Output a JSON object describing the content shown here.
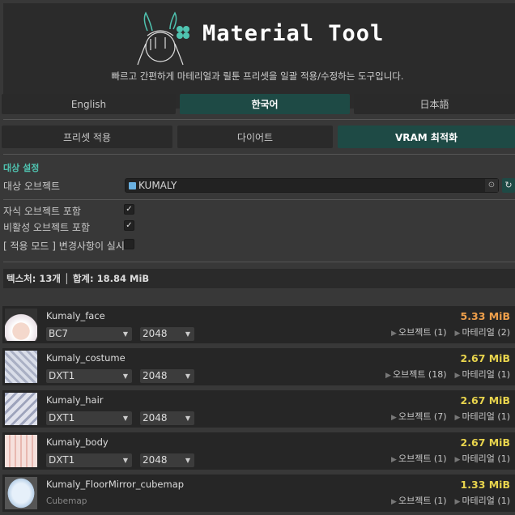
{
  "header": {
    "title": "Material Tool",
    "subtitle": "빠르고 간편하게 마테리얼과 릴툰 프리셋을 일괄 적용/수정하는 도구입니다."
  },
  "languages": [
    {
      "label": "English",
      "active": false
    },
    {
      "label": "한국어",
      "active": true
    },
    {
      "label": "日本語",
      "active": false
    }
  ],
  "modes": [
    {
      "label": "프리셋 적용",
      "active": false
    },
    {
      "label": "다이어트",
      "active": false
    },
    {
      "label": "VRAM 최적화",
      "active": true
    }
  ],
  "target": {
    "section": "대상 설정",
    "object_label": "대상 오브젝트",
    "object_value": "KUMALY"
  },
  "options": [
    {
      "label": "자식 오브젝트 포함",
      "checked": true,
      "mark": "✓"
    },
    {
      "label": "비활성 오브젝트 포함",
      "checked": true,
      "mark": "✓"
    },
    {
      "label": "[ 적용 모드 ]  변경사항이 실시",
      "checked": false,
      "mark": ""
    }
  ],
  "summary": "텍스처: 13개  │  합계: 18.84 MiB",
  "textures": [
    {
      "name": "Kumaly_face",
      "format": "BC7",
      "resolution": "2048",
      "size": "5.33 MiB",
      "objects": "오브젝트 (1)",
      "materials": "마테리얼 (2)"
    },
    {
      "name": "Kumaly_costume",
      "format": "DXT1",
      "resolution": "2048",
      "size": "2.67 MiB",
      "objects": "오브젝트 (18)",
      "materials": "마테리얼 (1)"
    },
    {
      "name": "Kumaly_hair",
      "format": "DXT1",
      "resolution": "2048",
      "size": "2.67 MiB",
      "objects": "오브젝트 (7)",
      "materials": "마테리얼 (1)"
    },
    {
      "name": "Kumaly_body",
      "format": "DXT1",
      "resolution": "2048",
      "size": "2.67 MiB",
      "objects": "오브젝트 (1)",
      "materials": "마테리얼 (1)"
    },
    {
      "name": "Kumaly_FloorMirror_cubemap",
      "type": "Cubemap",
      "size": "1.33 MiB",
      "objects": "오브젝트 (1)",
      "materials": "마테리얼 (1)"
    }
  ],
  "colors": {
    "accent": "#4fc3b0",
    "active": "#1e4a45",
    "size_large": "#f0a04b",
    "size_normal": "#e8d44d"
  }
}
